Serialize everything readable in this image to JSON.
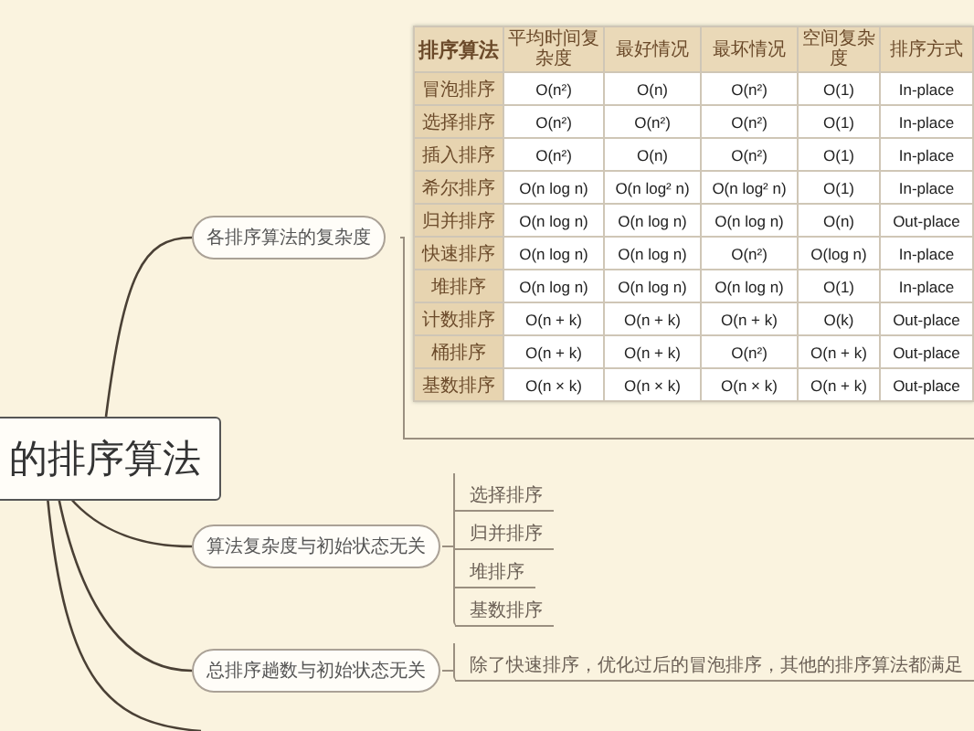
{
  "root": {
    "title": "的排序算法"
  },
  "branches": [
    {
      "kind": "table",
      "label": "各排序算法的复杂度",
      "table": {
        "columns": [
          "排序算法",
          "平均时间复杂度",
          "最好情况",
          "最坏情况",
          "空间复杂度",
          "排序方式"
        ],
        "rows": [
          [
            "冒泡排序",
            "O(n²)",
            "O(n)",
            "O(n²)",
            "O(1)",
            "In-place"
          ],
          [
            "选择排序",
            "O(n²)",
            "O(n²)",
            "O(n²)",
            "O(1)",
            "In-place"
          ],
          [
            "插入排序",
            "O(n²)",
            "O(n)",
            "O(n²)",
            "O(1)",
            "In-place"
          ],
          [
            "希尔排序",
            "O(n log n)",
            "O(n log² n)",
            "O(n log² n)",
            "O(1)",
            "In-place"
          ],
          [
            "归并排序",
            "O(n log n)",
            "O(n log n)",
            "O(n log n)",
            "O(n)",
            "Out-place"
          ],
          [
            "快速排序",
            "O(n log n)",
            "O(n log n)",
            "O(n²)",
            "O(log n)",
            "In-place"
          ],
          [
            "堆排序",
            "O(n log n)",
            "O(n log n)",
            "O(n log n)",
            "O(1)",
            "In-place"
          ],
          [
            "计数排序",
            "O(n + k)",
            "O(n + k)",
            "O(n + k)",
            "O(k)",
            "Out-place"
          ],
          [
            "桶排序",
            "O(n + k)",
            "O(n + k)",
            "O(n²)",
            "O(n + k)",
            "Out-place"
          ],
          [
            "基数排序",
            "O(n × k)",
            "O(n × k)",
            "O(n × k)",
            "O(n + k)",
            "Out-place"
          ]
        ]
      }
    },
    {
      "kind": "list",
      "label": "算法复杂度与初始状态无关",
      "items": [
        "选择排序",
        "归并排序",
        "堆排序",
        "基数排序"
      ]
    },
    {
      "kind": "note",
      "label": "总排序趟数与初始状态无关",
      "note": "除了快速排序，优化过后的冒泡排序，其他的排序算法都满足"
    }
  ]
}
